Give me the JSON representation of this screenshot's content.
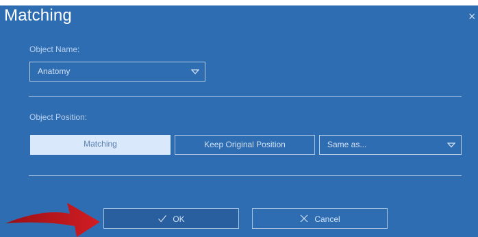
{
  "dialog": {
    "title": "Matching",
    "close_glyph": "×"
  },
  "object_name": {
    "label": "Object Name:",
    "selected": "Anatomy"
  },
  "object_position": {
    "label": "Object Position:",
    "options": [
      "Matching",
      "Keep Original Position"
    ],
    "active_option": "Matching",
    "same_as_selected": "Same as..."
  },
  "buttons": {
    "ok_label": "OK",
    "cancel_label": "Cancel"
  },
  "colors": {
    "dialog_bg": "#2f6db3",
    "active_segment_bg": "#d9e9fb",
    "annotation_arrow": "#c0191f"
  },
  "icons": {
    "close": "close-icon",
    "dropdown": "chevron-down-icon",
    "ok": "check-icon",
    "cancel": "x-icon",
    "annotation": "red-arrow-annotation"
  }
}
